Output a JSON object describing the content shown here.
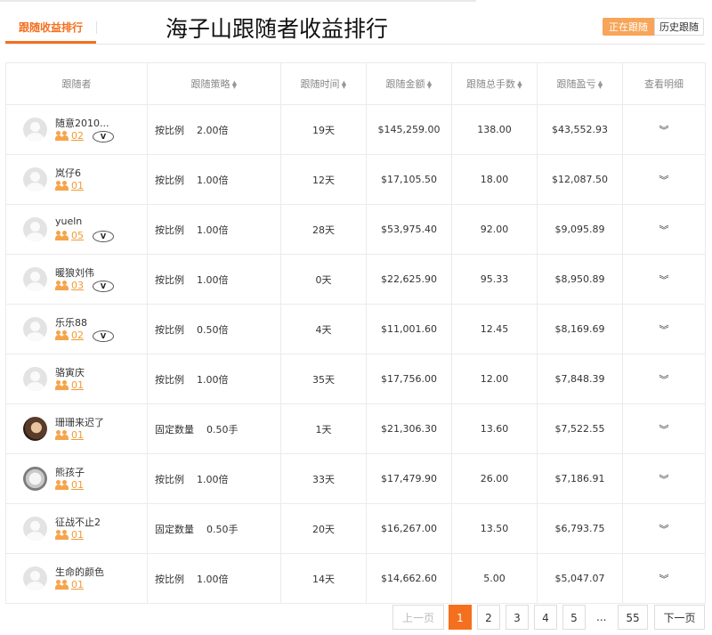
{
  "header": {
    "tab_label": "跟随收益排行",
    "title": "海子山跟随者收益排行",
    "toggle_on": "正在跟随",
    "toggle_off": "历史跟随"
  },
  "table": {
    "columns": [
      "跟随者",
      "跟随策略",
      "跟随时间",
      "跟随金额",
      "跟随总手数",
      "跟随盈亏",
      "查看明细"
    ],
    "rows": [
      {
        "name": "随意2010...",
        "count": "02",
        "badge": true,
        "avatar": "default",
        "strategy_type": "按比例",
        "strategy_value": "2.00倍",
        "time": "19天",
        "amount": "$145,259.00",
        "lots": "138.00",
        "pnl": "$43,552.93"
      },
      {
        "name": "岚仔6",
        "count": "01",
        "badge": false,
        "avatar": "default",
        "strategy_type": "按比例",
        "strategy_value": "1.00倍",
        "time": "12天",
        "amount": "$17,105.50",
        "lots": "18.00",
        "pnl": "$12,087.50"
      },
      {
        "name": "yueln",
        "count": "05",
        "badge": true,
        "avatar": "default",
        "strategy_type": "按比例",
        "strategy_value": "1.00倍",
        "time": "28天",
        "amount": "$53,975.40",
        "lots": "92.00",
        "pnl": "$9,095.89"
      },
      {
        "name": "暖狼刘伟",
        "count": "03",
        "badge": true,
        "avatar": "default",
        "strategy_type": "按比例",
        "strategy_value": "1.00倍",
        "time": "0天",
        "amount": "$22,625.90",
        "lots": "95.33",
        "pnl": "$8,950.89"
      },
      {
        "name": "乐乐88",
        "count": "02",
        "badge": true,
        "avatar": "default",
        "strategy_type": "按比例",
        "strategy_value": "0.50倍",
        "time": "4天",
        "amount": "$11,001.60",
        "lots": "12.45",
        "pnl": "$8,169.69"
      },
      {
        "name": "骆寅庆",
        "count": "01",
        "badge": false,
        "avatar": "default",
        "strategy_type": "按比例",
        "strategy_value": "1.00倍",
        "time": "35天",
        "amount": "$17,756.00",
        "lots": "12.00",
        "pnl": "$7,848.39"
      },
      {
        "name": "珊珊来迟了",
        "count": "01",
        "badge": false,
        "avatar": "photo1",
        "strategy_type": "固定数量",
        "strategy_value": "0.50手",
        "time": "1天",
        "amount": "$21,306.30",
        "lots": "13.60",
        "pnl": "$7,522.55"
      },
      {
        "name": "熊孩子",
        "count": "01",
        "badge": false,
        "avatar": "photo2",
        "strategy_type": "按比例",
        "strategy_value": "1.00倍",
        "time": "33天",
        "amount": "$17,479.90",
        "lots": "26.00",
        "pnl": "$7,186.91"
      },
      {
        "name": "征战不止2",
        "count": "01",
        "badge": false,
        "avatar": "default",
        "strategy_type": "固定数量",
        "strategy_value": "0.50手",
        "time": "20天",
        "amount": "$16,267.00",
        "lots": "13.50",
        "pnl": "$6,793.75"
      },
      {
        "name": "生命的颜色",
        "count": "01",
        "badge": false,
        "avatar": "default",
        "strategy_type": "按比例",
        "strategy_value": "1.00倍",
        "time": "14天",
        "amount": "$14,662.60",
        "lots": "5.00",
        "pnl": "$5,047.07"
      }
    ],
    "badge_text": "V",
    "expand_glyph": "︾"
  },
  "pagination": {
    "prev": "上一页",
    "pages": [
      "1",
      "2",
      "3",
      "4",
      "5"
    ],
    "current": "1",
    "ellipsis": "...",
    "last": "55",
    "next": "下一页"
  },
  "colors": {
    "accent": "#f46f1e",
    "profit": "#1fa060",
    "follow_count": "#f39b32"
  }
}
